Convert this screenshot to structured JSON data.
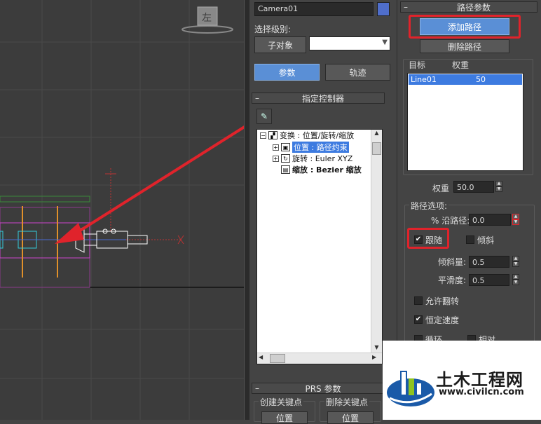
{
  "viewport": {
    "viewcube_label": "左",
    "bg_color": "#3c3c3c"
  },
  "command_panel": {
    "object_name": "Camera01",
    "object_color": "#4f6ecb",
    "selection_level_label": "选择级别:",
    "sub_object_button": "子对象",
    "tabs": [
      {
        "label": "参数",
        "active": true
      },
      {
        "label": "轨迹",
        "active": false
      }
    ],
    "assign_controller": {
      "title": "指定控制器",
      "tree": {
        "root": "变换 : 位置/旋转/缩放",
        "children": [
          {
            "label": "位置 : 路径约束",
            "selected": true
          },
          {
            "label": "旋转 : Euler XYZ",
            "selected": false
          },
          {
            "label": "缩放 : Bezier 缩放",
            "selected": false
          }
        ]
      }
    },
    "prs": {
      "title": "PRS 参数",
      "create_key_label": "创建关键点",
      "delete_key_label": "删除关键点",
      "create_position": "位置",
      "delete_position": "位置"
    }
  },
  "path_params": {
    "title": "路径参数",
    "add_path_button": "添加路径",
    "delete_path_button": "删除路径",
    "col_target": "目标",
    "col_weight": "权重",
    "rows": [
      {
        "target": "Line01",
        "weight": "50"
      }
    ],
    "weight_label": "权重",
    "weight_value": "50.0",
    "path_options_title": "路径选项:",
    "percent_label": "% 沿路径:",
    "percent_value": "0.0",
    "follow_label": "跟随",
    "follow_checked": true,
    "bank_label": "倾斜",
    "bank_checked": false,
    "bank_amount_label": "倾斜量:",
    "bank_amount_value": "0.5",
    "smoothness_label": "平滑度:",
    "smoothness_value": "0.5",
    "allow_upside_down_label": "允许翻转",
    "allow_upside_down_checked": false,
    "constant_velocity_label": "恒定速度",
    "constant_velocity_checked": true,
    "loop_label": "循环",
    "relative_label": "相对"
  },
  "watermark": {
    "title": "土木工程网",
    "url": "www.civilcn.com"
  },
  "annotation_color": "#e0232b"
}
